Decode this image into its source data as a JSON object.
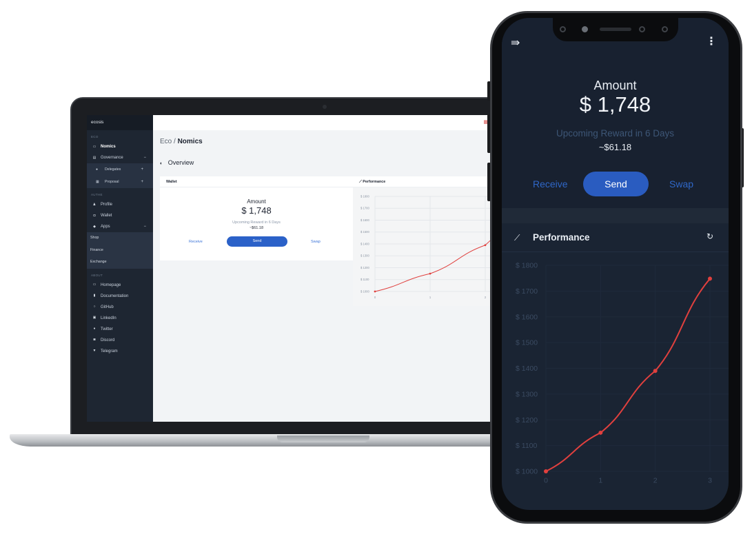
{
  "laptop": {
    "sidebar": {
      "brand": "ecosis",
      "section_eco": "ECO",
      "nomics": "Nomics",
      "governance": "Governance",
      "delegates": "Delegates",
      "proposal": "Proposal",
      "section_auth": "AUTHE",
      "profile": "Profile",
      "wallet": "Wallet",
      "apps": "Apps",
      "shop": "Shop",
      "finance": "Finance",
      "exchange": "Exchange",
      "section_about": "ABOUT",
      "homepage": "Homepage",
      "documentation": "Documentation",
      "github": "GitHub",
      "linkedin": "LinkedIn",
      "twitter": "Twitter",
      "discord": "Discord",
      "telegram": "Telegram",
      "minus": "−",
      "plus": "+"
    },
    "breadcrumb": {
      "root": "Eco",
      "separator": "/",
      "current": "Nomics"
    },
    "overview_title": "Overview",
    "wallet_card": {
      "title": "Wallet",
      "amount_label": "Amount",
      "amount": "$ 1,748",
      "upcoming": "Upcoming Reward in 6 Days",
      "reward": "~$61.18",
      "receive": "Receive",
      "send": "Send",
      "swap": "Swap"
    },
    "performance_title": "Performance"
  },
  "phone": {
    "amount_label": "Amount",
    "amount": "$ 1,748",
    "upcoming": "Upcoming Reward in 6 Days",
    "reward": "~$61.18",
    "receive": "Receive",
    "send": "Send",
    "swap": "Swap",
    "performance_title": "Performance"
  },
  "colors": {
    "accent": "#2b61c8",
    "line": "#e0403e",
    "sidebar": "#1e2632",
    "phone_bg": "#1a2433"
  },
  "chart_data": [
    {
      "type": "line",
      "title": "",
      "x": [
        0,
        1,
        2
      ],
      "series": [
        {
          "values": [
            1000,
            1150,
            1390
          ]
        }
      ],
      "y_ticks": [
        "$ 1000",
        "$ 1100",
        "$ 1200",
        "$ 1300",
        "$ 1400",
        "$ 1500",
        "$ 1600",
        "$ 1700",
        "$ 1800"
      ],
      "x_ticks": [
        "0",
        "1",
        "2"
      ],
      "ylim": [
        1000,
        1800
      ]
    },
    {
      "type": "line",
      "title": "",
      "x": [
        0,
        1,
        2,
        3
      ],
      "series": [
        {
          "values": [
            1000,
            1150,
            1390,
            1748
          ]
        }
      ],
      "y_ticks": [
        "$ 1000",
        "$ 1100",
        "$ 1200",
        "$ 1300",
        "$ 1400",
        "$ 1500",
        "$ 1600",
        "$ 1700",
        "$ 1800"
      ],
      "x_ticks": [
        "0",
        "1",
        "2",
        "3"
      ],
      "ylim": [
        1000,
        1800
      ]
    }
  ]
}
